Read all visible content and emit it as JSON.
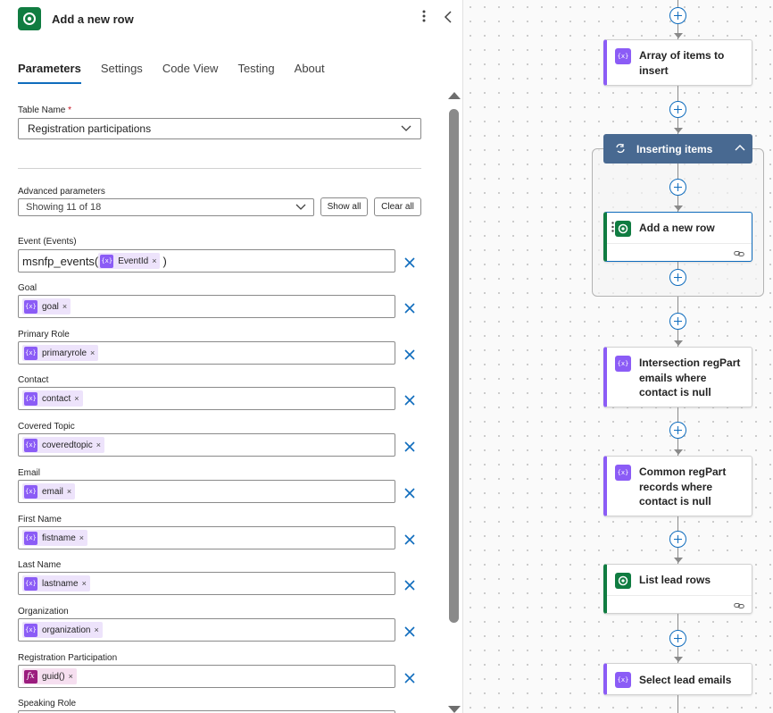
{
  "panel": {
    "title": "Add a new row",
    "tabs": [
      "Parameters",
      "Settings",
      "Code View",
      "Testing",
      "About"
    ],
    "active_tab": "Parameters",
    "table_name": {
      "label": "Table Name",
      "required_mark": "*",
      "value": "Registration participations"
    },
    "advanced": {
      "label": "Advanced parameters",
      "value": "Showing 11 of 18",
      "show_all": "Show all",
      "clear_all": "Clear all"
    },
    "event": {
      "label": "Event (Events)",
      "prefix": "msnfp_events(",
      "token": "EventId",
      "suffix": ")"
    },
    "fields": [
      {
        "label": "Goal",
        "token": "goal",
        "kind": "var"
      },
      {
        "label": "Primary Role",
        "token": "primaryrole",
        "kind": "var"
      },
      {
        "label": "Contact",
        "token": "contact",
        "kind": "var"
      },
      {
        "label": "Covered Topic",
        "token": "coveredtopic",
        "kind": "var"
      },
      {
        "label": "Email",
        "token": "email",
        "kind": "var"
      },
      {
        "label": "First Name",
        "token": "fistname",
        "kind": "var"
      },
      {
        "label": "Last Name",
        "token": "lastname",
        "kind": "var"
      },
      {
        "label": "Organization",
        "token": "organization",
        "kind": "var"
      },
      {
        "label": "Registration Participation",
        "token": "guid()",
        "kind": "fx"
      }
    ],
    "last_label": "Speaking Role",
    "token_remove": "×",
    "var_icon_text": "{x}",
    "fx_icon_text": "fx"
  },
  "canvas": {
    "cards": {
      "array_items": "Array of items to insert",
      "scope": "Inserting items",
      "add_row": "Add a new row",
      "intersection": "Intersection regPart emails where contact is null",
      "common": "Common regPart records where contact is null",
      "list_lead": "List lead rows",
      "select_lead": "Select lead emails"
    }
  },
  "colors": {
    "accent": "#0f6cbd",
    "dataverse": "#107c41",
    "variable": "#8b5cf6",
    "expression": "#9b1d7e",
    "scope_header": "#486991",
    "remove_x": "#0f6cbd"
  },
  "icons": [
    "dataverse-icon",
    "more-vertical-icon",
    "collapse-chevron-icon",
    "chevron-down-icon",
    "close-icon",
    "variable-icon",
    "fx-icon",
    "loop-icon",
    "link-icon",
    "plus-icon"
  ]
}
